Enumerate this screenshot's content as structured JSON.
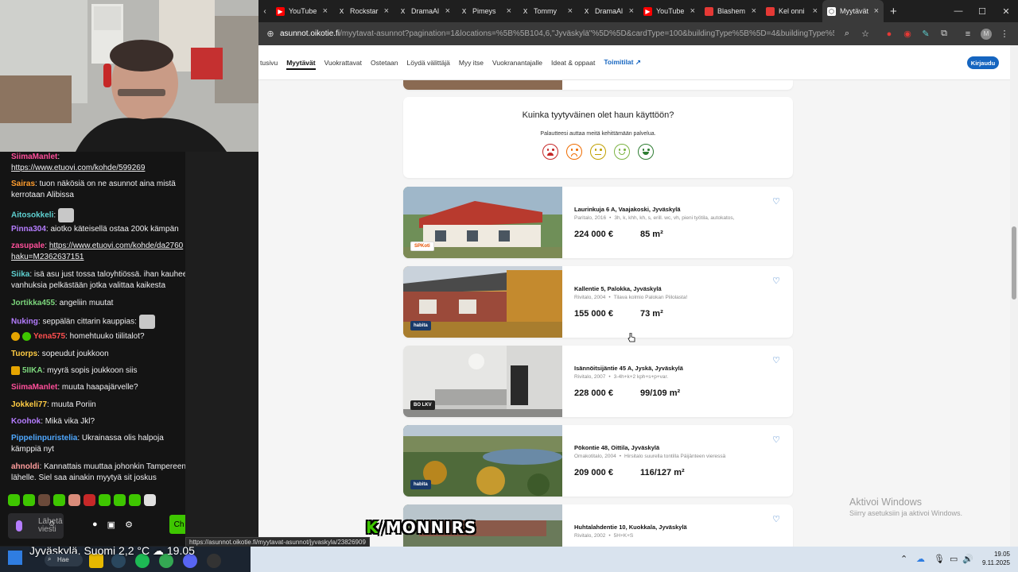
{
  "browser": {
    "tabs": [
      {
        "label": "YouTube",
        "icon": "youtube-icon",
        "color": "#ff0000"
      },
      {
        "label": "Rockstar",
        "icon": "x-icon",
        "color": "#000000"
      },
      {
        "label": "DramaAl",
        "icon": "x-icon",
        "color": "#000000"
      },
      {
        "label": "Pimeys",
        "icon": "x-icon",
        "color": "#000000"
      },
      {
        "label": "Tommy",
        "icon": "x-icon",
        "color": "#000000"
      },
      {
        "label": "DramaAl",
        "icon": "x-icon",
        "color": "#000000"
      },
      {
        "label": "YouTube",
        "icon": "youtube-icon",
        "color": "#ff0000"
      },
      {
        "label": "Blashem",
        "icon": "bookmark-icon",
        "color": "#e53935"
      },
      {
        "label": "Kel onni",
        "icon": "bookmark-icon",
        "color": "#e53935"
      },
      {
        "label": "Myytävät",
        "icon": "oikotie-icon",
        "color": "#ffffff",
        "active": true
      }
    ],
    "url_host": "asunnot.oikotie.fi",
    "url_path": "/myytavat-asunnot?pagination=1&locations=%5B%5B104,6,\"Jyväskylä\"%5D%5D&cardType=100&buildingType%5B%5D=4&buildingType%5B%5D=8&..."
  },
  "site": {
    "nav": [
      "tusivu",
      "Myytävät",
      "Vuokrattavat",
      "Ostetaan",
      "Löydä välittäjä",
      "Myy itse",
      "Vuokranantajalle",
      "Ideat & oppaat"
    ],
    "nav_active": "Myytävät",
    "partner_link": "Toimitilat",
    "login": "Kirjaudu"
  },
  "feedback": {
    "question": "Kuinka tyytyväinen olet haun käyttöön?",
    "subtitle": "Palautteesi auttaa meitä kehittämään palvelua."
  },
  "listings": [
    {
      "address": "Laurinkuja 6 A, Vaajakoski, Jyväskylä",
      "type_year": "Paritalo, 2016",
      "desc": "3h, k, khh, kh, s, erill. wc, vh, pieni työtila, autokatos,",
      "price": "224 000 €",
      "area": "85 m²",
      "agency": "SPKoti"
    },
    {
      "address": "Kallentie 5, Palokka, Jyväskylä",
      "type_year": "Rivitalo, 2004",
      "desc": "Tilava kolmio Palokan Piilolasta!",
      "price": "155 000 €",
      "area": "73 m²",
      "agency": "habita"
    },
    {
      "address": "Isännöitsijäntie 45 A, Jyskä, Jyväskylä",
      "type_year": "Rivitalo, 2007",
      "desc": "3-4h+k+2 kph+s+p+var.",
      "price": "228 000 €",
      "area": "99/109 m²",
      "agency": "BO LKV"
    },
    {
      "address": "Pökontie 48, Oittila, Jyväskylä",
      "type_year": "Omakotitalo, 2004",
      "desc": "Hirsitalo suurella tontilla Päijänteen vieressä",
      "price": "209 000 €",
      "area": "116/127 m²",
      "agency": "habita"
    },
    {
      "address": "Huhtalahdentie 10, Kuokkala, Jyväskylä",
      "type_year": "Rivitalo, 2002",
      "desc": "5H+K+S",
      "price": "",
      "area": "",
      "agency": ""
    }
  ],
  "watermark": {
    "title": "Aktivoi Windows",
    "subtitle": "Siirry asetuksiin ja aktivoi Windows."
  },
  "status_url": "https://asunnot.oikotie.fi/myytavat-asunnot/jyvaskyla/23826909",
  "chat": {
    "messages": [
      {
        "user": "SiimaManlet",
        "color": "#ff4f9a",
        "text": ""
      },
      {
        "user": "",
        "color": "#ffffff",
        "text": "https://www.etuovi.com/kohde/599269",
        "link": true
      },
      {
        "user": "Sairas",
        "color": "#ff9d2e",
        "text": "tuon näkösiä on ne asunnot aina mistä"
      },
      {
        "user": "",
        "color": "#ffffff",
        "text": "kerrotaan Alibissa"
      },
      {
        "user": "Aitosokkeli",
        "color": "#5ed1d1",
        "text": ""
      },
      {
        "user": "Pinna304",
        "color": "#b57dff",
        "text": "aiotko käteisellä ostaa 200k kämpän"
      },
      {
        "user": "zasupale",
        "color": "#ff4f9a",
        "text": "https://www.etuovi.com/kohde/da2760",
        "link": true
      },
      {
        "user": "",
        "color": "#ffffff",
        "text": "haku=M2362637151",
        "link": true
      },
      {
        "user": "Siika",
        "color": "#5ed1d1",
        "text": "isä asu just tossa taloyhtiössä. ihan kauhee"
      },
      {
        "user": "",
        "color": "#ffffff",
        "text": "vanhuksia pelkästään jotka valittaa kaikesta"
      },
      {
        "user": "Jortikka455",
        "color": "#7cd67c",
        "text": "angeliin muutat"
      },
      {
        "user": "Nuking",
        "color": "#b57dff",
        "text": "seppälän cittarin kauppias:"
      },
      {
        "user": "Yena575",
        "color": "#ff4f4f",
        "text": "homehtuuko tiilitalot?"
      },
      {
        "user": "Tuorps",
        "color": "#ffcc44",
        "text": "sopeudut joukkoon"
      },
      {
        "user": "5IIKA",
        "color": "#7cd67c",
        "text": "myyrä sopis joukkoon siis"
      },
      {
        "user": "SiimaManlet",
        "color": "#ff4f9a",
        "text": "muuta haapajärvelle?"
      },
      {
        "user": "Jokkeli77",
        "color": "#ffcc44",
        "text": "muuta Poriin"
      },
      {
        "user": "Koohok",
        "color": "#b57dff",
        "text": "Mikä vika Jkl?"
      },
      {
        "user": "Pippelinpuristelia",
        "color": "#4fa8ff",
        "text": "Ukrainassa olis halpoja"
      },
      {
        "user": "",
        "color": "#ffffff",
        "text": "kämppiä nyt"
      },
      {
        "user": "ahnoldi",
        "color": "#ff9d9d",
        "text": "Kannattais muuttaa johonkin Tampereen"
      },
      {
        "user": "",
        "color": "#ffffff",
        "text": "lähelle. Siel saa ainakin myytyä sit joskus"
      }
    ],
    "input_placeholder": "Lähetä viesti",
    "send_label": "Ch"
  },
  "overlay_logo": {
    "k": "K",
    "rest": "/MONNIRS"
  },
  "taskbar": {
    "weather": "Jyväskylä, Suomi  2,2 °C",
    "weather_time": "19.05",
    "search": "Hae",
    "time": "19.05",
    "date": "9.11.2025"
  }
}
